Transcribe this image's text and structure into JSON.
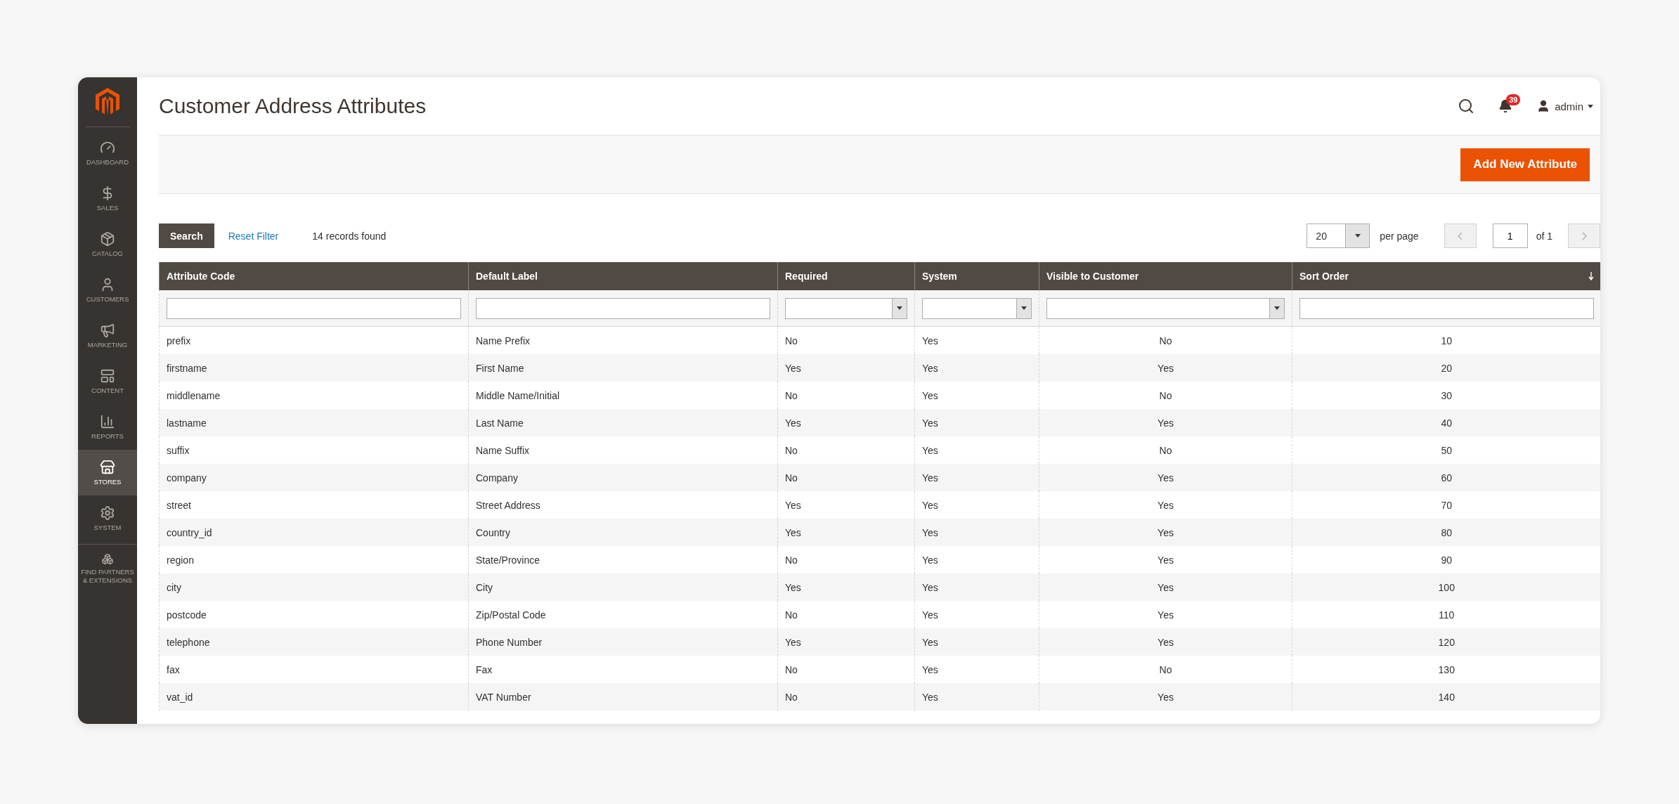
{
  "sidebar": {
    "items": [
      {
        "label": "DASHBOARD",
        "selected": false
      },
      {
        "label": "SALES",
        "selected": false
      },
      {
        "label": "CATALOG",
        "selected": false
      },
      {
        "label": "CUSTOMERS",
        "selected": false
      },
      {
        "label": "MARKETING",
        "selected": false
      },
      {
        "label": "CONTENT",
        "selected": false
      },
      {
        "label": "REPORTS",
        "selected": false
      },
      {
        "label": "STORES",
        "selected": true
      },
      {
        "label": "SYSTEM",
        "selected": false
      },
      {
        "label": "FIND PARTNERS & EXTENSIONS",
        "selected": false
      }
    ]
  },
  "header": {
    "title": "Customer Address Attributes",
    "notifications": "39",
    "user": "admin"
  },
  "actions": {
    "add_button": "Add New Attribute"
  },
  "toolbar": {
    "search_button": "Search",
    "reset_link": "Reset Filter",
    "records": "14 records found",
    "page_size": "20",
    "per_page": "per page",
    "page": "1",
    "of_pages": "of 1",
    "prev_disabled": true,
    "next_disabled": true
  },
  "table": {
    "columns": [
      {
        "label": "Attribute Code",
        "kind": "text",
        "sorted": false
      },
      {
        "label": "Default Label",
        "kind": "text",
        "sorted": false
      },
      {
        "label": "Required",
        "kind": "select",
        "sorted": false
      },
      {
        "label": "System",
        "kind": "select",
        "sorted": false
      },
      {
        "label": "Visible to Customer",
        "kind": "select",
        "sorted": false
      },
      {
        "label": "Sort Order",
        "kind": "text",
        "sorted": true
      }
    ],
    "rows": [
      [
        "prefix",
        "Name Prefix",
        "No",
        "Yes",
        "No",
        "10"
      ],
      [
        "firstname",
        "First Name",
        "Yes",
        "Yes",
        "Yes",
        "20"
      ],
      [
        "middlename",
        "Middle Name/Initial",
        "No",
        "Yes",
        "No",
        "30"
      ],
      [
        "lastname",
        "Last Name",
        "Yes",
        "Yes",
        "Yes",
        "40"
      ],
      [
        "suffix",
        "Name Suffix",
        "No",
        "Yes",
        "No",
        "50"
      ],
      [
        "company",
        "Company",
        "No",
        "Yes",
        "Yes",
        "60"
      ],
      [
        "street",
        "Street Address",
        "Yes",
        "Yes",
        "Yes",
        "70"
      ],
      [
        "country_id",
        "Country",
        "Yes",
        "Yes",
        "Yes",
        "80"
      ],
      [
        "region",
        "State/Province",
        "No",
        "Yes",
        "Yes",
        "90"
      ],
      [
        "city",
        "City",
        "Yes",
        "Yes",
        "Yes",
        "100"
      ],
      [
        "postcode",
        "Zip/Postal Code",
        "No",
        "Yes",
        "Yes",
        "110"
      ],
      [
        "telephone",
        "Phone Number",
        "Yes",
        "Yes",
        "Yes",
        "120"
      ],
      [
        "fax",
        "Fax",
        "No",
        "Yes",
        "No",
        "130"
      ],
      [
        "vat_id",
        "VAT Number",
        "No",
        "Yes",
        "Yes",
        "140"
      ]
    ]
  }
}
